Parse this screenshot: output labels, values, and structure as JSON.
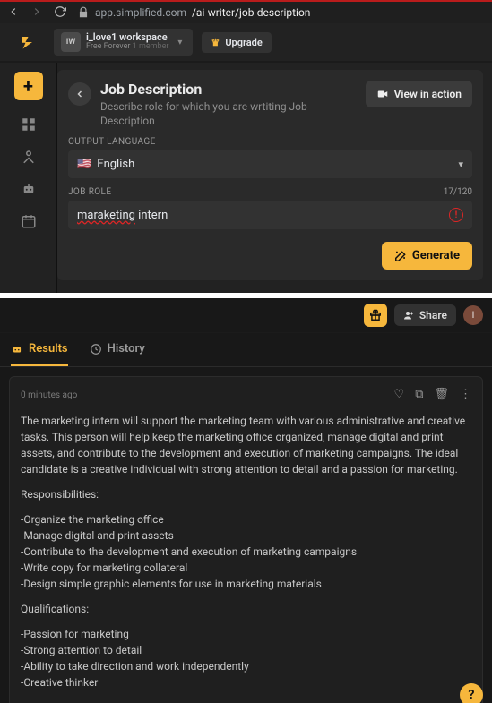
{
  "browser": {
    "url_host": "app.simplified.com",
    "url_path": "/ai-writer/job-description"
  },
  "workspace": {
    "avatar": "IW",
    "name": "i_love1 workspace",
    "plan": "Free Forever",
    "members": "1 member"
  },
  "upgrade": {
    "label": "Upgrade"
  },
  "hero": {
    "back": "←",
    "title": "Job Description",
    "subtitle": "Describe role for which you are wrtiting Job Description",
    "view_action": "View in action"
  },
  "form": {
    "output_language_label": "OUTPUT LANGUAGE",
    "language_display": "English",
    "flag": "🇺🇸",
    "job_role_label": "JOB ROLE",
    "job_role_count": "17/120",
    "job_role_value_misspelled": "maraketing",
    "job_role_value_rest": " intern",
    "generate": "Generate"
  },
  "bottombar": {
    "share": "Share",
    "avatar_letter": "I"
  },
  "tabs": {
    "results": "Results",
    "history": "History"
  },
  "result": {
    "timestamp": "0 minutes ago",
    "paragraph": "The marketing intern will support the marketing team with various administrative and creative tasks. This person will help keep the marketing office organized, manage digital and print assets, and contribute to the development and execution of marketing campaigns. The ideal candidate is a creative individual with strong attention to detail and a passion for marketing.",
    "resp_header": "Responsibilities:",
    "responsibilities": [
      "-Organize the marketing office",
      "-Manage digital and print assets",
      "-Contribute to the development and execution of marketing campaigns",
      "-Write copy for marketing collateral",
      "-Design simple graphic elements for use in marketing materials"
    ],
    "qual_header": "Qualifications:",
    "qualifications": [
      "-Passion for marketing",
      "-Strong attention to detail",
      "-Ability to take direction and work independently",
      "-Creative thinker"
    ]
  },
  "help": "?"
}
